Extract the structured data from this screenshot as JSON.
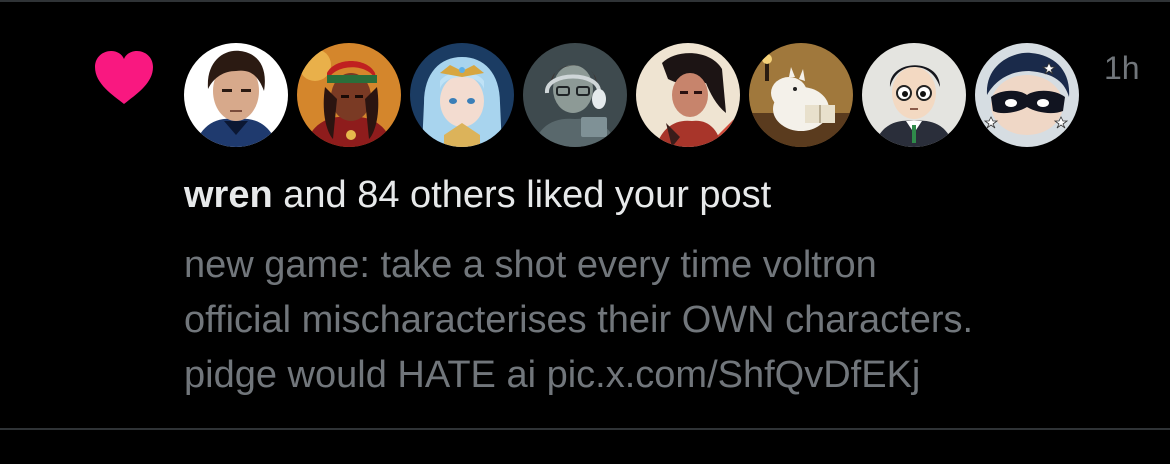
{
  "notification": {
    "timestamp": "1h",
    "actor_name": "wren",
    "action_text": "and 84 others liked your post",
    "post_lines": [
      "new game: take a shot every time voltron",
      "official mischaracterises their OWN characters.",
      "pidge would HATE ai pic.x.com/ShfQvDfEKj"
    ]
  },
  "icons": {
    "like": "heart-icon"
  },
  "colors": {
    "background": "#000000",
    "heart": "#f91880",
    "primary_text": "#e7e9ea",
    "secondary_text": "#71767b",
    "divider": "#2f3336"
  }
}
